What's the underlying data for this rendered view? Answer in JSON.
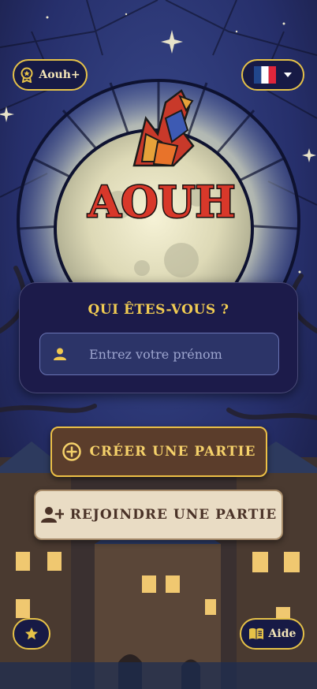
{
  "header": {
    "premium_label": "Aouh+",
    "language_flag": "french-flag"
  },
  "logo": {
    "text": "AOUH"
  },
  "identity_card": {
    "title": "QUI ÊTES-VOUS ?",
    "name_placeholder": "Entrez votre prénom",
    "name_value": ""
  },
  "actions": {
    "create_label": "CRÉER UNE PARTIE",
    "join_label": "REJOINDRE UNE PARTIE"
  },
  "footer": {
    "help_label": "Aide"
  },
  "colors": {
    "gold": "#e6c248",
    "navy": "#171a45",
    "brown": "#5b3d2b",
    "parchment": "#e9dcc4"
  }
}
